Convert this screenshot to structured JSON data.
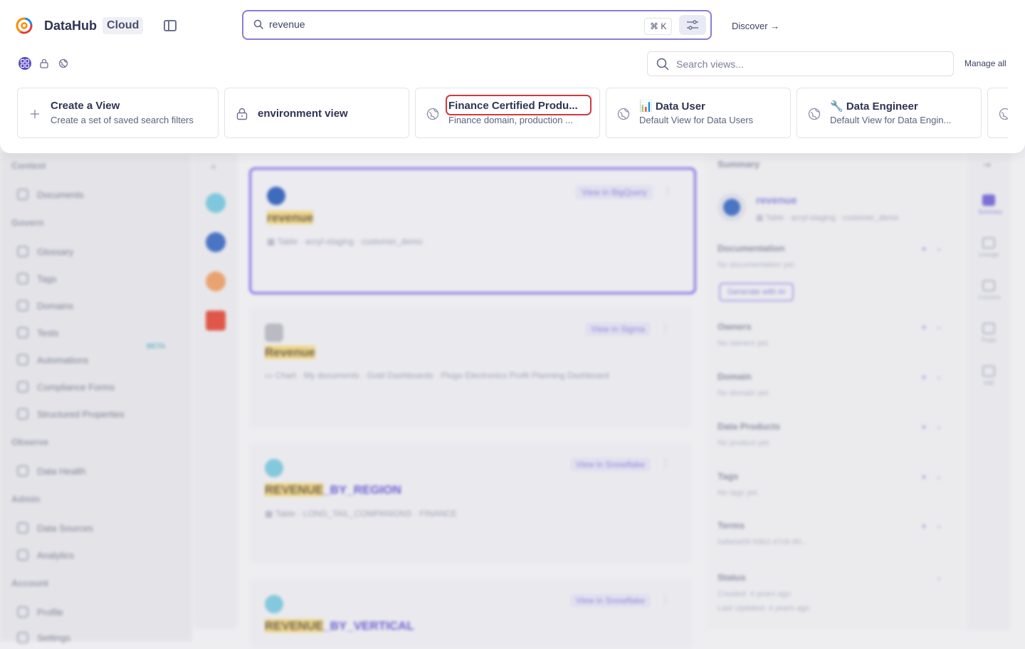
{
  "brand": {
    "name": "DataHub",
    "edition": "Cloud"
  },
  "search": {
    "query": "revenue",
    "shortcut": "⌘ K"
  },
  "discover_label": "Discover →",
  "views_search": {
    "placeholder": "Search views...",
    "manage_label": "Manage all"
  },
  "view_types": [
    {
      "icon": "grid-icon",
      "active": true
    },
    {
      "icon": "lock-icon",
      "active": false
    },
    {
      "icon": "globe-icon",
      "active": false
    }
  ],
  "views": [
    {
      "icon": "plus-icon",
      "title": "Create a View",
      "description": "Create a set of saved search filters"
    },
    {
      "icon": "lock-icon",
      "title": "environment view",
      "description": ""
    },
    {
      "icon": "globe-icon",
      "title": "Finance Certified Produ...",
      "description": "Finance domain, production ...",
      "highlighted": true
    },
    {
      "icon": "globe-icon",
      "title": "📊 Data User",
      "description": "Default View for Data Users"
    },
    {
      "icon": "globe-icon",
      "title": "🔧 Data Engineer",
      "description": "Default View for Data Engin..."
    }
  ],
  "background": {
    "sidebar": {
      "sections": [
        {
          "title": "Context",
          "items": [
            "Documents"
          ]
        },
        {
          "title": "Govern",
          "items": [
            "Glossary",
            "Tags",
            "Domains",
            "Tests",
            "Automations",
            "Compliance Forms",
            "Structured Properties"
          ]
        },
        {
          "title": "Observe",
          "items": [
            "Data Health"
          ]
        },
        {
          "title": "Admin",
          "items": [
            "Data Sources",
            "Analytics"
          ]
        },
        {
          "title": "Account",
          "items": [
            "Profile",
            "Settings"
          ]
        }
      ],
      "beta_badge": "BETA"
    },
    "results": [
      {
        "name_highlight": "revenue",
        "name_rest": "",
        "meta": "▦ Table · acryl-staging · customer_demo",
        "view_label": "View in BigQuery",
        "selected": true
      },
      {
        "name_highlight": "Revenue",
        "name_rest": "",
        "meta": "▭ Chart · My documents · Gold Dashboards · Plugo Electronics Profit Planning Dashboard",
        "view_label": "View in Sigma",
        "selected": false
      },
      {
        "name_highlight": "REVENUE",
        "name_rest": "_BY_REGION",
        "meta": "▦ Table · LONG_TAIL_COMPANIONS · FINANCE",
        "view_label": "View in Snowflake",
        "selected": false
      },
      {
        "name_highlight": "REVENUE",
        "name_rest": "_BY_VERTICAL",
        "meta": "",
        "view_label": "View in Snowflake",
        "selected": false
      }
    ],
    "summary": {
      "header": "Summary",
      "entity_name": "revenue",
      "entity_meta": "▦ Table · acryl-staging · customer_demo",
      "sections": [
        {
          "title": "Documentation",
          "empty": "No documentation yet."
        },
        {
          "title": "Owners",
          "empty": "No owners yet."
        },
        {
          "title": "Domain",
          "empty": "No domain yet."
        },
        {
          "title": "Data Products",
          "empty": "No product yet."
        },
        {
          "title": "Tags",
          "empty": "No tags yet."
        },
        {
          "title": "Terms",
          "empty": "0afa0a59-93b2-47cb-90..."
        },
        {
          "title": "Status",
          "empty": "Created: 4 years ago"
        }
      ],
      "generate_label": "Generate with AI",
      "last_updated": "Last Updated: 4 years ago"
    },
    "rail": [
      "Summary",
      "Lineage",
      "Columns",
      "Props",
      "Add"
    ]
  }
}
